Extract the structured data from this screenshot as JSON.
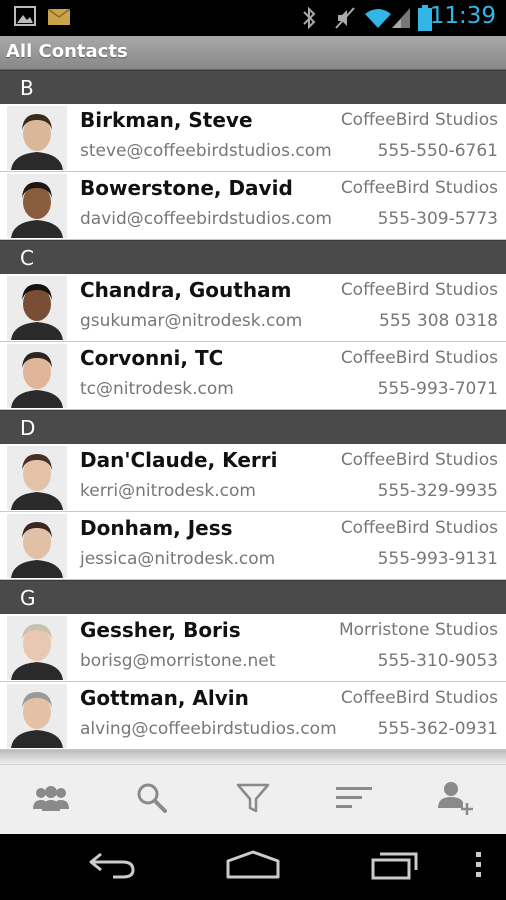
{
  "status_bar": {
    "time": "11:39",
    "icons": [
      "image-icon",
      "mail-icon",
      "bluetooth-icon",
      "mute-icon",
      "wifi-icon",
      "signal-icon",
      "battery-icon"
    ]
  },
  "header": {
    "title": "All Contacts"
  },
  "sections": [
    {
      "letter": "B",
      "contacts": [
        {
          "name": "Birkman, Steve",
          "email": "steve@coffeebirdstudios.com",
          "company": "CoffeeBird Studios",
          "phone": "555-550-6761"
        },
        {
          "name": "Bowerstone, David",
          "email": "david@coffeebirdstudios.com",
          "company": "CoffeeBird Studios",
          "phone": "555-309-5773"
        }
      ]
    },
    {
      "letter": "C",
      "contacts": [
        {
          "name": "Chandra, Goutham",
          "email": "gsukumar@nitrodesk.com",
          "company": "CoffeeBird Studios",
          "phone": "555 308 0318"
        },
        {
          "name": "Corvonni, TC",
          "email": "tc@nitrodesk.com",
          "company": "CoffeeBird Studios",
          "phone": "555-993-7071"
        }
      ]
    },
    {
      "letter": "D",
      "contacts": [
        {
          "name": "Dan'Claude, Kerri",
          "email": "kerri@nitrodesk.com",
          "company": "CoffeeBird Studios",
          "phone": "555-329-9935"
        },
        {
          "name": "Donham, Jess",
          "email": "jessica@nitrodesk.com",
          "company": "CoffeeBird Studios",
          "phone": "555-993-9131"
        }
      ]
    },
    {
      "letter": "G",
      "contacts": [
        {
          "name": "Gessher, Boris",
          "email": "borisg@morristone.net",
          "company": "Morristone Studios",
          "phone": "555-310-9053"
        },
        {
          "name": "Gottman, Alvin",
          "email": "alving@coffeebirdstudios.com",
          "company": "CoffeeBird Studios",
          "phone": "555-362-0931"
        }
      ]
    }
  ],
  "toolbar": {
    "buttons": [
      "contacts-group-icon",
      "search-icon",
      "filter-icon",
      "sort-icon",
      "add-contact-icon"
    ]
  },
  "nav": {
    "buttons": [
      "back-icon",
      "home-icon",
      "recent-apps-icon",
      "menu-icon"
    ]
  },
  "colors": {
    "accent": "#33b5e5",
    "section_bg": "#4a4a4a",
    "toolbar_bg": "#efefef",
    "icon_gray": "#8a8a8a"
  }
}
